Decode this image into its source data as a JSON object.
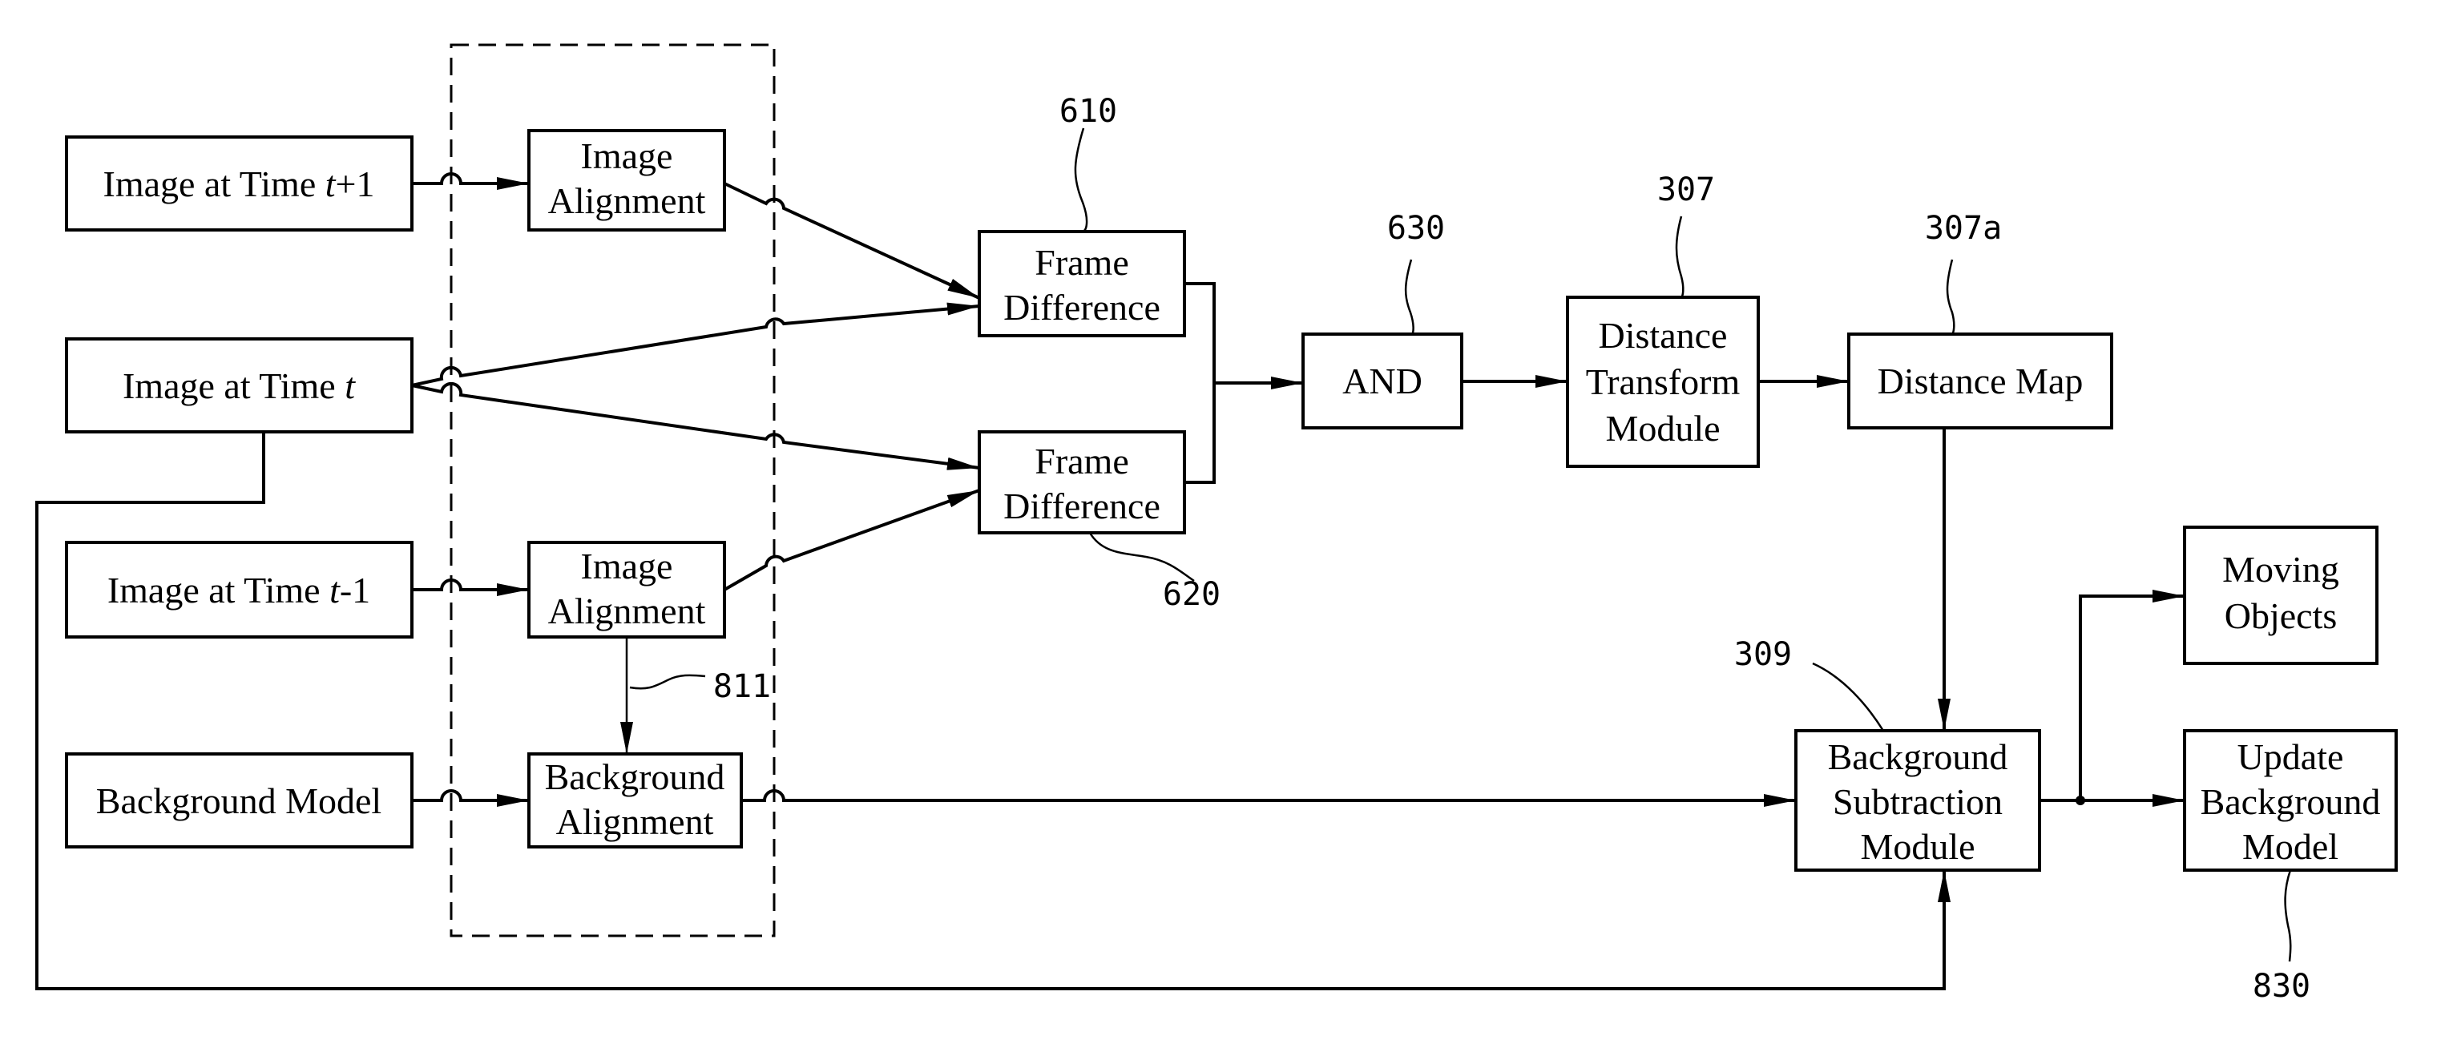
{
  "blocks": {
    "image_t_plus_1": {
      "prefix": "Image at Time ",
      "var": "t",
      "suffix": "+1"
    },
    "image_t": {
      "prefix": "Image at Time ",
      "var": "t",
      "suffix": ""
    },
    "image_t_minus_1": {
      "prefix": "Image at Time ",
      "var": "t",
      "suffix": "-1"
    },
    "background_model": {
      "lines": [
        "Background Model"
      ]
    },
    "image_alignment_top": {
      "lines": [
        "Image",
        "Alignment"
      ]
    },
    "image_alignment_bottom": {
      "lines": [
        "Image",
        "Alignment"
      ]
    },
    "background_alignment": {
      "lines": [
        "Background",
        "Alignment"
      ]
    },
    "frame_difference_top": {
      "lines": [
        "Frame",
        "Difference"
      ]
    },
    "frame_difference_bottom": {
      "lines": [
        "Frame",
        "Difference"
      ]
    },
    "and_gate": {
      "lines": [
        "AND"
      ]
    },
    "distance_transform": {
      "lines": [
        "Distance",
        "Transform",
        "Module"
      ]
    },
    "distance_map": {
      "lines": [
        "Distance Map"
      ]
    },
    "background_subtraction": {
      "lines": [
        "Background",
        "Subtraction",
        "Module"
      ]
    },
    "moving_objects": {
      "lines": [
        "Moving",
        "Objects"
      ]
    },
    "update_background": {
      "lines": [
        "Update",
        "Background",
        "Model"
      ]
    }
  },
  "references": {
    "r610": "610",
    "r620": "620",
    "r630": "630",
    "r307": "307",
    "r307a": "307a",
    "r309": "309",
    "r811": "811",
    "r830": "830"
  }
}
